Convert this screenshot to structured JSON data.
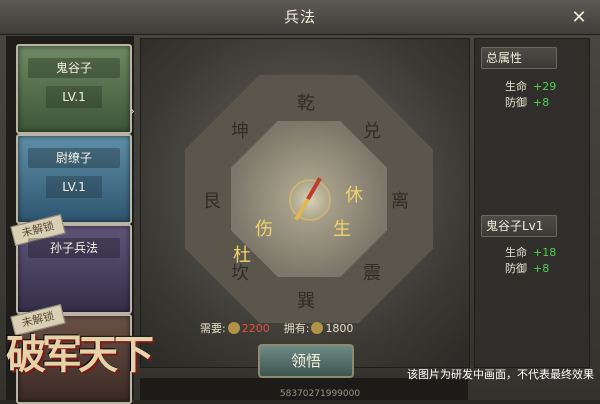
{
  "window": {
    "title": "兵法"
  },
  "strategies": [
    {
      "name": "鬼谷子",
      "level": "LV.1",
      "locked": false
    },
    {
      "name": "尉缭子",
      "level": "LV.1",
      "locked": false
    },
    {
      "name": "孙子兵法",
      "lock_label": "未解锁",
      "locked": true
    },
    {
      "lock_label": "未解锁",
      "locked": true
    }
  ],
  "compass": {
    "glyphs_outer": [
      "乾",
      "兑",
      "离",
      "震",
      "巽",
      "坎",
      "艮",
      "坤"
    ],
    "glyphs_inner_gold": [
      "休",
      "生",
      "伤",
      "杜"
    ]
  },
  "cost": {
    "need_label": "需要:",
    "need_value": "2200",
    "have_label": "拥有:",
    "have_value": "1800"
  },
  "learn_button": "领悟",
  "attributes": {
    "total_title": "总属性",
    "total": [
      {
        "label": "生命",
        "value": "+29"
      },
      {
        "label": "防御",
        "value": "+8"
      }
    ],
    "skill_title": "鬼谷子Lv1",
    "skill": [
      {
        "label": "生命",
        "value": "+18"
      },
      {
        "label": "防御",
        "value": "+8"
      }
    ]
  },
  "logo_text": "破军天下",
  "notice": "该图片为研发中画面，不代表最终效果",
  "bottom_number": "58370271999000",
  "colors": {
    "gain": "#50d050",
    "cost_need": "#e25042",
    "gold_glyph": "#f2d36b"
  }
}
